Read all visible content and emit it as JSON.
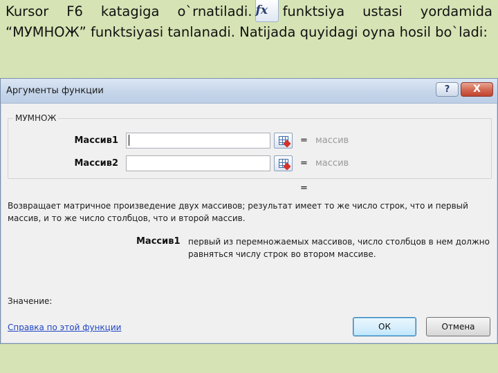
{
  "slide": {
    "text_before": "Kursor F6 katagiga o`rnatiladi.",
    "fx_icon": "fx",
    "text_after": "funktsiya ustasi yordamida “МУМНОЖ” funktsiyasi tanlanadi. Natijada quyidagi oyna hosil bo`ladi:"
  },
  "dialog": {
    "title": "Аргументы функции",
    "help_glyph": "?",
    "close_glyph": "X",
    "function_name": "МУМНОЖ",
    "args": [
      {
        "label": "Массив1",
        "value": "",
        "equals": "=",
        "hint": "массив"
      },
      {
        "label": "Массив2",
        "value": "",
        "equals": "=",
        "hint": "массив"
      }
    ],
    "result_equals": "=",
    "description": "Возвращает матричное произведение двух массивов; результат имеет то же число строк, что и первый массив, и то же число столбцов, что и второй массив.",
    "param_name": "Массив1",
    "param_description": "первый из перемножаемых массивов, число столбцов в нем должно равняться числу строк во втором массиве.",
    "value_label": "Значение:",
    "help_link": "Справка по этой функции",
    "ok_label": "ОК",
    "cancel_label": "Отмена"
  },
  "colors": {
    "slide_background": "#d6e3b4",
    "dialog_background": "#f0f0f0",
    "close_button": "#c0432d",
    "link": "#1f44c4"
  }
}
